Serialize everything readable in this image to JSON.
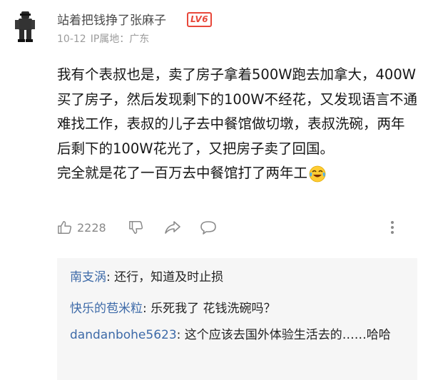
{
  "comment": {
    "username": "站着把钱挣了张麻子",
    "level_badge": "LV6",
    "date": "10-12",
    "ip_label": "IP属地：广东",
    "paragraphs": [
      "我有个表叔也是，卖了房子拿着500W跑去加拿大，400W买了房子，然后发现剩下的100W不经花，又发现语言不通难找工作，表叔的儿子去中餐馆做切墩，表叔洗碗，两年后剩下的100W花光了，又把房子卖了回国。",
      "完全就是花了一百万去中餐馆打了两年工"
    ],
    "emoji_icon": "laughing-tears-emoji",
    "like_count": "2228"
  },
  "replies": [
    {
      "author": "南支涡",
      "text": "还行，知道及时止损"
    },
    {
      "author": "快乐的苞米粒",
      "text": "乐死我了 花钱洗碗吗？"
    },
    {
      "author": "dandanbohe5623",
      "text": "这个应该去国外体验生活去的……哈哈"
    }
  ],
  "colors": {
    "badge": "#e8473a",
    "reply_author": "#3d6aa8",
    "reply_bg": "#f6f6f6"
  }
}
